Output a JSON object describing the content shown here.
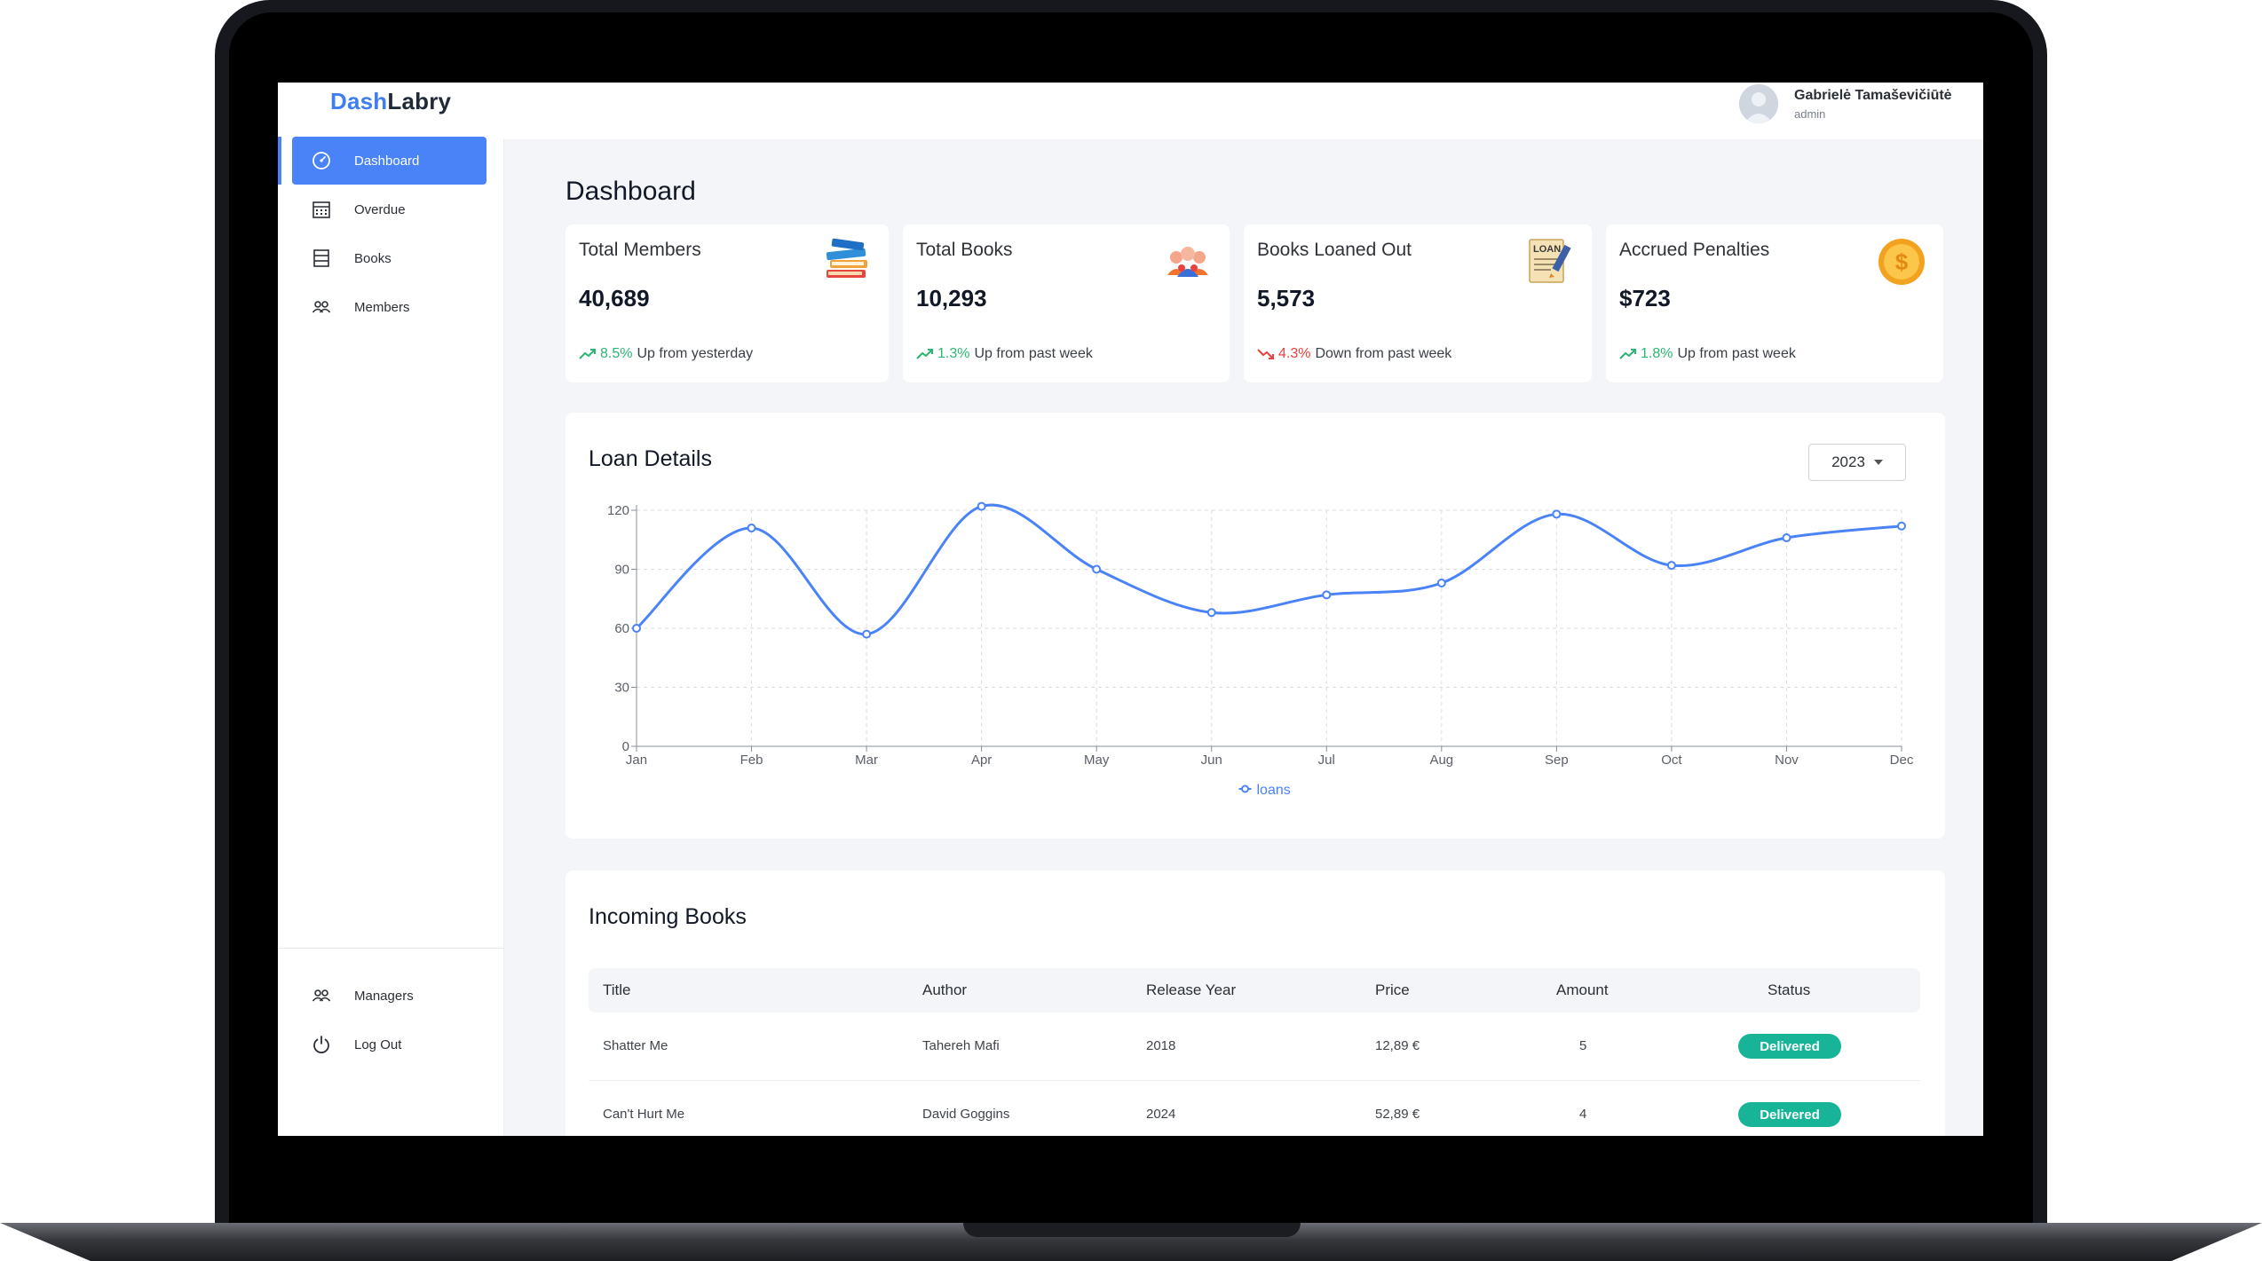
{
  "app": {
    "logo_part1": "Dash",
    "logo_part2": "Labry"
  },
  "sidebar": {
    "items": [
      {
        "label": "Dashboard",
        "icon": "speedometer-icon",
        "active": true
      },
      {
        "label": "Overdue",
        "icon": "calendar-icon"
      },
      {
        "label": "Books",
        "icon": "book-list-icon"
      },
      {
        "label": "Members",
        "icon": "users-icon"
      }
    ],
    "bottom_items": [
      {
        "label": "Managers",
        "icon": "users-icon"
      },
      {
        "label": "Log Out",
        "icon": "power-icon"
      }
    ]
  },
  "user": {
    "name": "Gabrielė Tamaševičiūtė",
    "role": "admin"
  },
  "page": {
    "title": "Dashboard"
  },
  "cards": [
    {
      "title": "Total Members",
      "value": "40,689",
      "pct": "8.5%",
      "trend_text": "Up from yesterday",
      "direction": "up",
      "icon": "stacked-books-icon"
    },
    {
      "title": "Total Books",
      "value": "10,293",
      "pct": "1.3%",
      "trend_text": "Up from past week",
      "direction": "up",
      "icon": "people-group-icon"
    },
    {
      "title": "Books Loaned Out",
      "value": "5,573",
      "pct": "4.3%",
      "trend_text": "Down from past week",
      "direction": "down",
      "icon": "loan-document-icon"
    },
    {
      "title": "Accrued Penalties",
      "value": "$723",
      "pct": "1.8%",
      "trend_text": "Up from past week",
      "direction": "up",
      "icon": "dollar-coin-icon"
    }
  ],
  "loan_details": {
    "title": "Loan Details",
    "year": "2023"
  },
  "chart_data": {
    "type": "line",
    "categories": [
      "Jan",
      "Feb",
      "Mar",
      "Apr",
      "May",
      "Jun",
      "Jul",
      "Aug",
      "Sep",
      "Oct",
      "Nov",
      "Dec"
    ],
    "series": [
      {
        "name": "loans",
        "values": [
          60,
          111,
          57,
          122,
          90,
          68,
          77,
          83,
          118,
          92,
          106,
          112
        ]
      }
    ],
    "yticks": [
      0,
      30,
      60,
      90,
      120
    ],
    "ylim": [
      0,
      120
    ],
    "grid": true,
    "smooth": true,
    "legend": "bottom-center",
    "color": "#4a83f7"
  },
  "incoming_books": {
    "title": "Incoming Books",
    "columns": [
      "Title",
      "Author",
      "Release Year",
      "Price",
      "Amount",
      "Status"
    ],
    "rows": [
      [
        "Shatter Me",
        "Tahereh Mafi",
        "2018",
        "12,89 €",
        "5",
        "Delivered"
      ],
      [
        "Can't Hurt Me",
        "David Goggins",
        "2024",
        "52,89 €",
        "4",
        "Delivered"
      ]
    ]
  },
  "colors": {
    "accent": "#4a83f7",
    "up": "#2bb673",
    "down": "#e8413e",
    "delivered": "#17b497"
  }
}
